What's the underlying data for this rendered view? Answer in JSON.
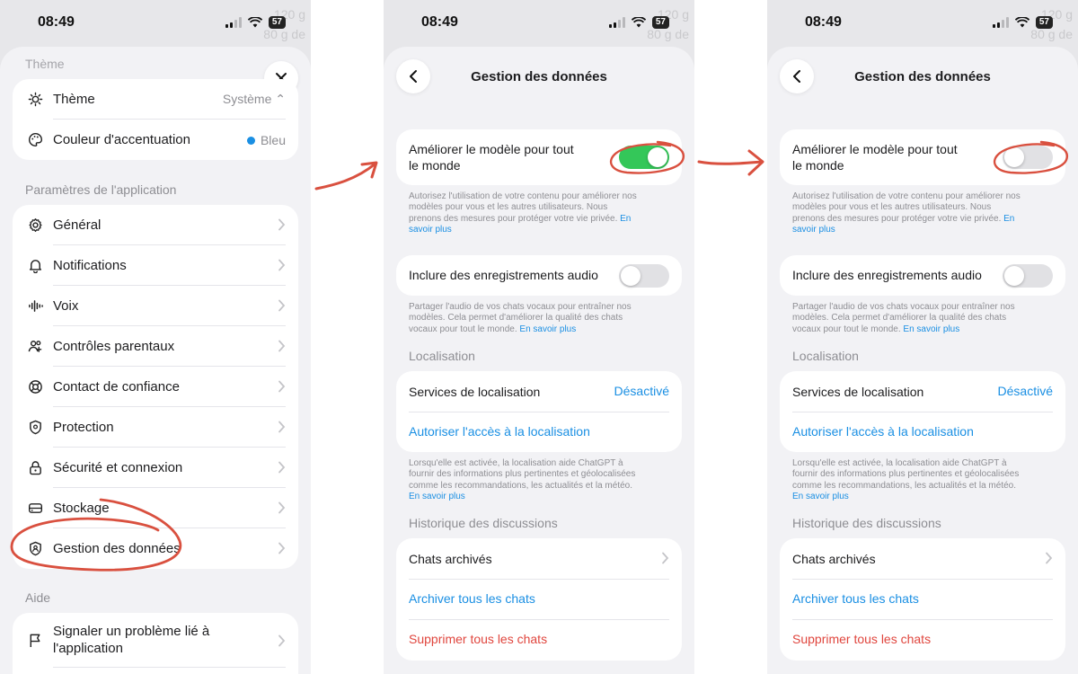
{
  "status_bar": {
    "time": "08:49",
    "battery": "57"
  },
  "background_hint": {
    "line1": "120 g",
    "line2": "80 g de",
    "line3": "80 g de"
  },
  "screen1": {
    "theme_section_title": "Thème",
    "theme_label": "Thème",
    "theme_value": "Système ⌃",
    "accent_label": "Couleur d'accentuation",
    "accent_value": "Bleu",
    "accent_color": "#1a8fe3",
    "app_settings_title": "Paramètres de l'application",
    "items": [
      {
        "label": "Général",
        "icon": "gear-icon"
      },
      {
        "label": "Notifications",
        "icon": "bell-icon"
      },
      {
        "label": "Voix",
        "icon": "waveform-icon"
      },
      {
        "label": "Contrôles parentaux",
        "icon": "people-icon"
      },
      {
        "label": "Contact de confiance",
        "icon": "lifebuoy-icon"
      },
      {
        "label": "Protection",
        "icon": "shield-icon"
      },
      {
        "label": "Sécurité et connexion",
        "icon": "lock-icon"
      },
      {
        "label": "Stockage",
        "icon": "storage-icon"
      },
      {
        "label": "Gestion des données",
        "icon": "data-control-icon"
      }
    ],
    "help_title": "Aide",
    "report_line1": "Signaler un problème lié à",
    "report_line2": "l'application"
  },
  "data_screen": {
    "title": "Gestion des données",
    "improve_line1": "Améliorer le modèle pour tout",
    "improve_line2": "le monde",
    "improve_desc_1": "Autorisez l'utilisation de votre contenu pour améliorer nos",
    "improve_desc_2": "modèles pour vous et les autres utilisateurs. Nous",
    "improve_desc_3": "prenons des mesures pour protéger votre vie privée.",
    "link_part1": "En",
    "link_part2": "savoir plus",
    "audio_label": "Inclure des enregistrements audio",
    "audio_desc_1": "Partager l'audio de vos chats vocaux pour entraîner nos",
    "audio_desc_2": "modèles. Cela permet d'améliorer la qualité des chats",
    "audio_desc_3": "vocaux pour tout le monde.",
    "learn_more": "En savoir plus",
    "location_section": "Localisation",
    "location_services": "Services de localisation",
    "location_value": "Désactivé",
    "allow_location": "Autoriser l'accès à la localisation",
    "loc_desc_1": "Lorsqu'elle est activée, la localisation aide ChatGPT à",
    "loc_desc_2": "fournir des informations plus pertinentes et géolocalisées",
    "loc_desc_3": "comme les recommandations, les actualités et la météo.",
    "history_section": "Historique des discussions",
    "archived_chats": "Chats archivés",
    "archive_all": "Archiver tous les chats",
    "delete_all": "Supprimer tous les chats"
  },
  "toggles": {
    "before": {
      "improve_model_on": true,
      "audio_on": false
    },
    "after": {
      "improve_model_on": false,
      "audio_on": false
    }
  },
  "annotation_color": "#d9503f",
  "switch_on_color": "#34c759"
}
